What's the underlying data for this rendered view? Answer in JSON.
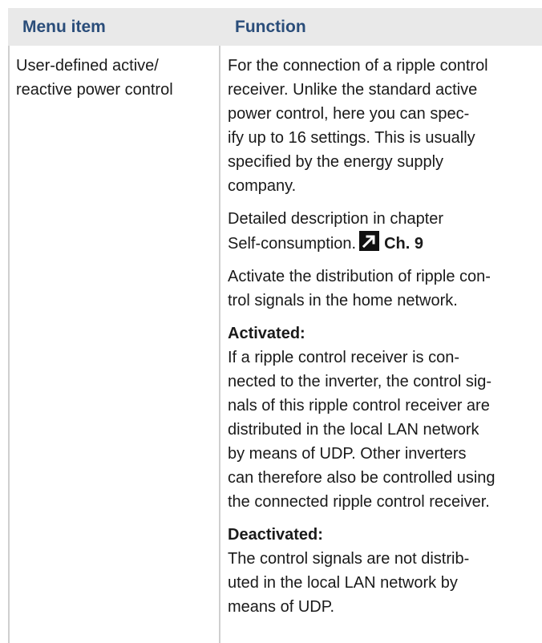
{
  "header": {
    "col_menu_item": "Menu item",
    "col_function": "Function"
  },
  "row": {
    "menu_item_line1": "User-defined active/",
    "menu_item_line2": "reactive power control",
    "function": {
      "p1": [
        "For the connection of a ripple control",
        "receiver. Unlike the standard active",
        "power control, here you can spec-",
        "ify up to 16 settings. This is usually",
        "specified by the energy supply",
        "company."
      ],
      "p2_line1": "Detailed description in chapter",
      "p2_line2": "Self-consumption.",
      "p2_ref": "Ch. 9",
      "p3": [
        "Activate the distribution of ripple con-",
        "trol signals in the home network."
      ],
      "activated_label": "Activated:",
      "activated_text": [
        "If a ripple control receiver is con-",
        "nected to the inverter, the control sig-",
        "nals of this ripple control receiver are",
        "distributed in the local LAN network",
        "by means of UDP. Other inverters",
        "can therefore also be controlled using",
        "the connected ripple control receiver."
      ],
      "deactivated_label": "Deactivated:",
      "deactivated_text": [
        "The control signals are not distrib-",
        "uted in the local LAN network by",
        "means of UDP."
      ]
    }
  }
}
